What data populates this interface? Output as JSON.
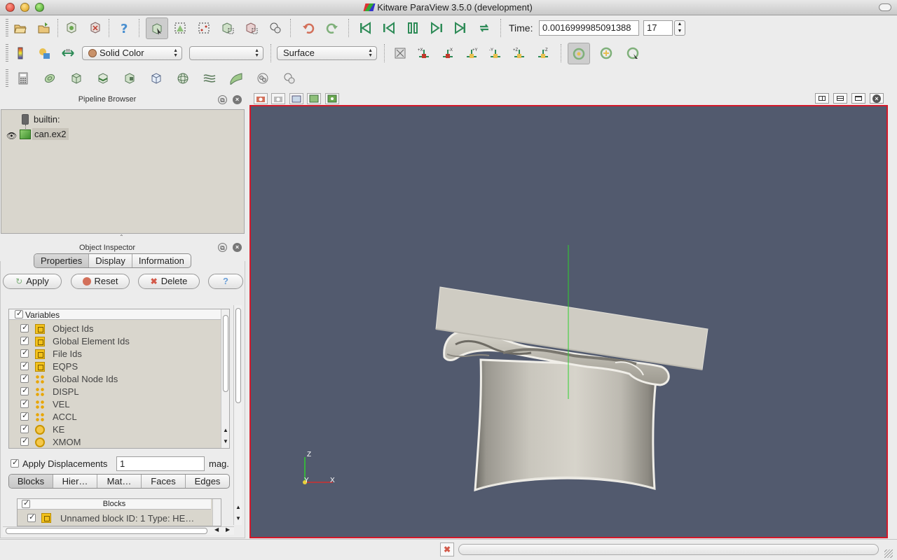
{
  "window": {
    "title": "Kitware ParaView 3.5.0 (development)"
  },
  "toolbar": {
    "time_label": "Time:",
    "time_value": "0.0016999985091388",
    "timestep_value": "17",
    "color_by": "Solid Color",
    "component": "",
    "representation": "Surface"
  },
  "pipeline": {
    "title": "Pipeline Browser",
    "items": [
      {
        "label": "builtin:"
      },
      {
        "label": "can.ex2"
      }
    ]
  },
  "inspector": {
    "title": "Object Inspector",
    "tabs": [
      "Properties",
      "Display",
      "Information"
    ],
    "buttons": {
      "apply": "Apply",
      "reset": "Reset",
      "delete": "Delete",
      "help": "?"
    },
    "variables_header": "Variables",
    "variables": [
      {
        "name": "Object Ids",
        "icon": "cell-icon"
      },
      {
        "name": "Global Element Ids",
        "icon": "cell-icon"
      },
      {
        "name": "File Ids",
        "icon": "cell-icon"
      },
      {
        "name": "EQPS",
        "icon": "cell-icon"
      },
      {
        "name": "Global Node Ids",
        "icon": "node-icon"
      },
      {
        "name": "DISPL",
        "icon": "node-icon"
      },
      {
        "name": "VEL",
        "icon": "node-icon"
      },
      {
        "name": "ACCL",
        "icon": "node-icon"
      },
      {
        "name": "KE",
        "icon": "global-icon"
      },
      {
        "name": "XMOM",
        "icon": "global-icon"
      }
    ],
    "apply_displacements_label": "Apply Displacements",
    "displacement_value": "1",
    "displacement_unit": "mag.",
    "block_tabs": [
      "Blocks",
      "Hier…",
      "Mat…",
      "Faces",
      "Edges"
    ],
    "blocks_header": "Blocks",
    "blocks": [
      {
        "name": "Unnamed block ID: 1 Type: HE…"
      }
    ]
  },
  "viewport": {
    "axes": {
      "x": "X",
      "y": "Y",
      "z": "Z"
    }
  },
  "colors": {
    "viewport_bg": "#525a6e",
    "active_border": "#d4192a",
    "panel_bg": "#d9d6cd",
    "model": "#cfccc3"
  }
}
